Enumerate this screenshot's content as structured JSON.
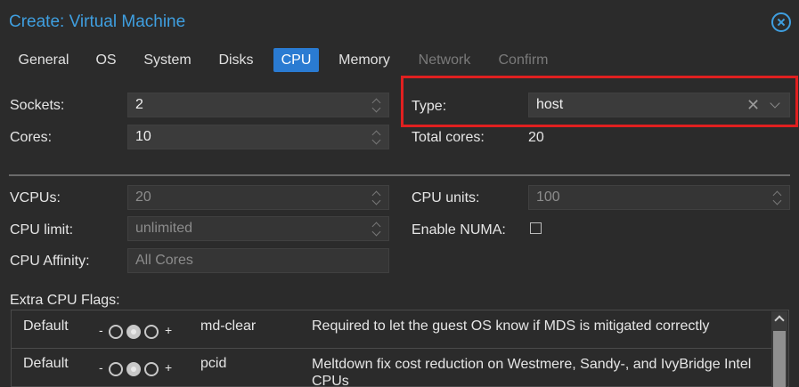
{
  "window": {
    "title": "Create: Virtual Machine"
  },
  "tabs": [
    {
      "label": "General"
    },
    {
      "label": "OS"
    },
    {
      "label": "System"
    },
    {
      "label": "Disks"
    },
    {
      "label": "CPU"
    },
    {
      "label": "Memory"
    },
    {
      "label": "Network"
    },
    {
      "label": "Confirm"
    }
  ],
  "active_tab": "CPU",
  "form": {
    "sockets": {
      "label": "Sockets:",
      "value": "2"
    },
    "cores": {
      "label": "Cores:",
      "value": "10"
    },
    "type": {
      "label": "Type:",
      "value": "host"
    },
    "total_cores": {
      "label": "Total cores:",
      "value": "20"
    },
    "vcpus": {
      "label": "VCPUs:",
      "value": "20"
    },
    "cpu_units": {
      "label": "CPU units:",
      "value": "100"
    },
    "cpu_limit": {
      "label": "CPU limit:",
      "value": "unlimited"
    },
    "enable_numa": {
      "label": "Enable NUMA:",
      "checked": false
    },
    "cpu_affinity": {
      "label": "CPU Affinity:",
      "placeholder": "All Cores"
    }
  },
  "flags": {
    "label": "Extra CPU Flags:",
    "rows": [
      {
        "state": "Default",
        "minus": "-",
        "plus": "+",
        "flag": "md-clear",
        "description": "Required to let the guest OS know if MDS is mitigated correctly"
      },
      {
        "state": "Default",
        "minus": "-",
        "plus": "+",
        "flag": "pcid",
        "description": "Meltdown fix cost reduction on Westmere, Sandy-, and IvyBridge Intel CPUs"
      }
    ]
  },
  "icons": {
    "close": "close-circle-icon",
    "clear": "clear-x-icon",
    "dropdown": "chevron-down-icon"
  },
  "colors": {
    "accent": "#3f9fe0",
    "active_tab": "#2a7bd2",
    "highlight": "#e02020"
  }
}
